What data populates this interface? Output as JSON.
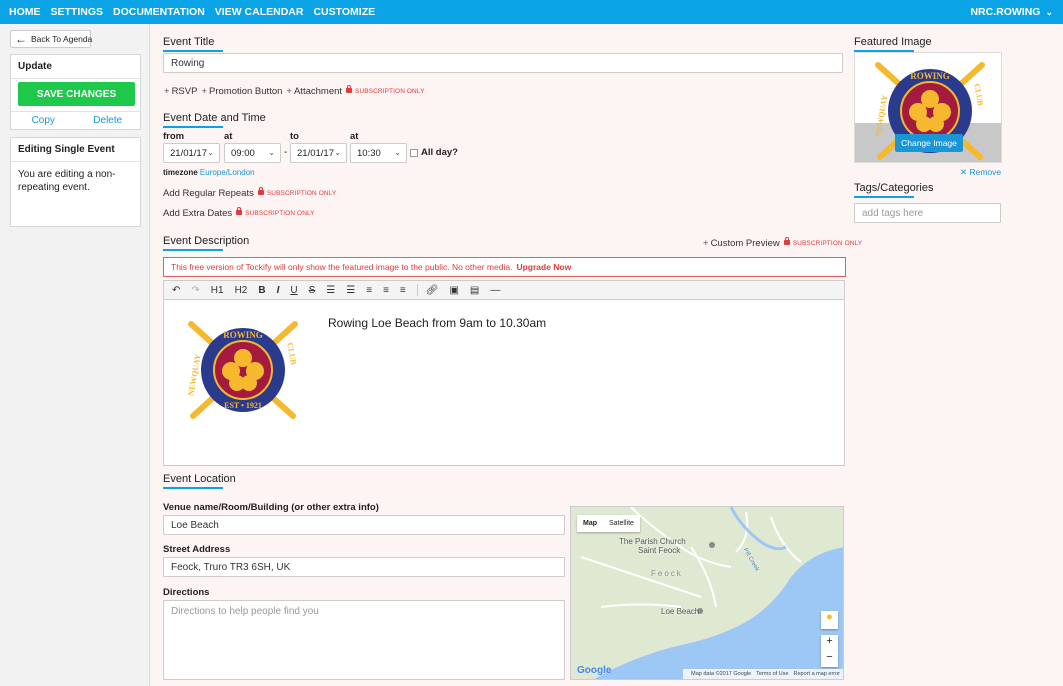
{
  "nav": {
    "links": [
      "HOME",
      "SETTINGS",
      "DOCUMENTATION",
      "VIEW CALENDAR",
      "CUSTOMIZE"
    ],
    "account": "NRC.ROWING"
  },
  "sidebar": {
    "back_label": "Back To Agenda",
    "update_title": "Update",
    "save_label": "SAVE CHANGES",
    "copy_label": "Copy",
    "delete_label": "Delete",
    "editing_title": "Editing Single Event",
    "editing_text": "You are editing a non-repeating event."
  },
  "event_title": {
    "heading": "Event Title",
    "value": "Rowing"
  },
  "extras": {
    "rsvp": "RSVP",
    "promotion": "Promotion Button",
    "attachment": "Attachment",
    "subscription_only": "SUBSCRIPTION ONLY"
  },
  "datetime": {
    "heading": "Event Date and Time",
    "from_label": "from",
    "at_label": "at",
    "to_label": "to",
    "start_date": "21/01/17",
    "start_time": "09:00",
    "end_date": "21/01/17",
    "end_time": "10:30",
    "allday_label": "All day?",
    "allday_checked": false,
    "timezone_label": "timezone",
    "timezone_value": "Europe/London",
    "regular_repeats": "Add Regular Repeats",
    "extra_dates": "Add Extra Dates"
  },
  "description": {
    "heading": "Event Description",
    "custom_preview": "Custom Preview",
    "warning": "This free version of Tockify will only show the featured image to the public. No other media.",
    "upgrade": "Upgrade Now",
    "toolbar_h1": "H1",
    "toolbar_h2": "H2",
    "toolbar_bold": "B",
    "toolbar_italic": "I",
    "toolbar_underline": "U",
    "toolbar_strike": "S",
    "body_text": "Rowing Loe Beach from 9am to 10.30am"
  },
  "location": {
    "heading": "Event Location",
    "venue_label": "Venue name/Room/Building (or other extra info)",
    "venue_value": "Loe Beach",
    "street_label": "Street Address",
    "street_value": "Feock, Truro TR3 6SH, UK",
    "directions_label": "Directions",
    "directions_placeholder": "Directions to help people find you"
  },
  "map": {
    "tab_map": "Map",
    "tab_satellite": "Satellite",
    "place_church": "The Parish Church",
    "place_church2": "Saint Feock",
    "place_feock": "Feock",
    "place_beach": "Loe Beach",
    "place_creek": "Pill Creek",
    "google": "Google",
    "zoom_in": "+",
    "zoom_out": "−",
    "footer_data": "Map data ©2017 Google",
    "footer_terms": "Terms of Use",
    "footer_report": "Report a map error",
    "colors": {
      "land": "#dfe9d2",
      "water": "#9dc7f5",
      "road": "#ffffff"
    }
  },
  "logo": {
    "top_text": "ROWING",
    "left_text": "NEWQUAY",
    "right_text": "CLUB",
    "bottom_text": "EST • 1921",
    "colors": {
      "ring": "#2a3a8c",
      "center": "#a31c3f",
      "gold": "#f5b82e"
    }
  },
  "featured": {
    "heading": "Featured Image",
    "change_label": "Change Image",
    "remove_label": "Remove"
  },
  "tags": {
    "heading": "Tags/Categories",
    "placeholder": "add tags here"
  },
  "colors": {
    "accent": "#0aa3e6",
    "save": "#1ec84a",
    "warn": "#e23a3a",
    "link": "#1a95d6"
  }
}
